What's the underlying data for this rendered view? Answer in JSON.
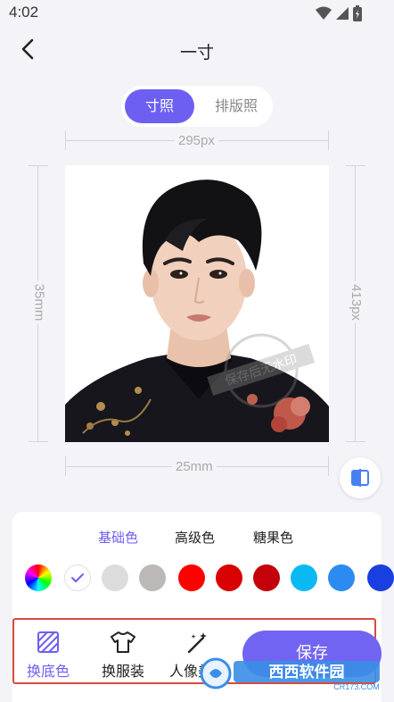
{
  "status_bar": {
    "time": "4:02"
  },
  "nav": {
    "title": "一寸"
  },
  "segmented": {
    "active": "寸照",
    "inactive": "排版照"
  },
  "dimensions": {
    "width_px": "295px",
    "height_mm": "35mm",
    "height_px": "413px",
    "width_mm": "25mm"
  },
  "photo_watermark": "保存后无水印",
  "color_tabs": [
    "基础色",
    "高级色",
    "糖果色"
  ],
  "swatches": [
    {
      "name": "rainbow",
      "color": "conic"
    },
    {
      "name": "white-selected",
      "color": "#ffffff"
    },
    {
      "name": "light-gray",
      "color": "#dcdcdc"
    },
    {
      "name": "gray",
      "color": "#bcb8b8"
    },
    {
      "name": "red",
      "color": "#ff0000"
    },
    {
      "name": "dark-red",
      "color": "#d80000"
    },
    {
      "name": "crimson",
      "color": "#c4000b"
    },
    {
      "name": "sky-blue",
      "color": "#0ab9f2"
    },
    {
      "name": "blue",
      "color": "#2c8bf0"
    },
    {
      "name": "royal-blue",
      "color": "#1a3fe0"
    }
  ],
  "colors": {
    "accent": "#6e5ff3",
    "highlight_frame": "#d94a3e"
  },
  "toolbar": {
    "change_bg": "换底色",
    "change_clothes": "换服装",
    "beauty": "人像美颜",
    "save": "保存"
  },
  "site_watermark": {
    "brand": "西西软件园",
    "url": "CR173.COM"
  }
}
